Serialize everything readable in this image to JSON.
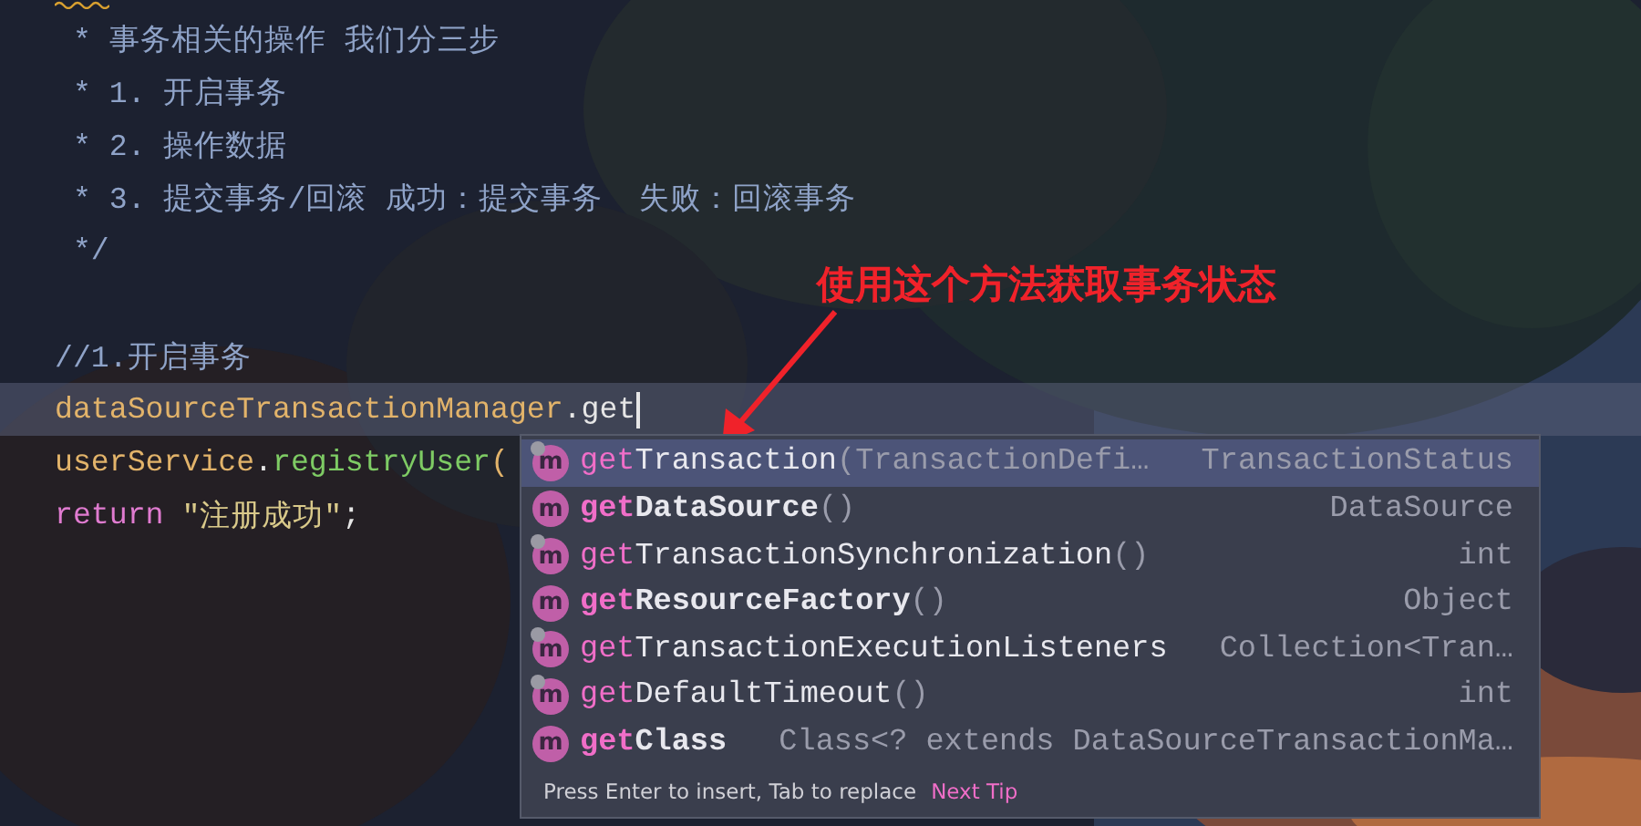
{
  "editor": {
    "lines": [
      {
        "current": false,
        "tokens": [
          {
            "kind": "comment",
            "text": " * 事务相关的操作 我们分三步"
          }
        ]
      },
      {
        "current": false,
        "tokens": [
          {
            "kind": "comment",
            "text": " * 1. 开启事务"
          }
        ]
      },
      {
        "current": false,
        "tokens": [
          {
            "kind": "comment",
            "text": " * 2. 操作数据"
          }
        ]
      },
      {
        "current": false,
        "tokens": [
          {
            "kind": "comment",
            "text": " * 3. 提交事务/回滚 成功：提交事务  失败：回滚事务"
          }
        ]
      },
      {
        "current": false,
        "tokens": [
          {
            "kind": "comment",
            "text": " */"
          }
        ]
      },
      {
        "current": false
      },
      {
        "current": false,
        "tokens": [
          {
            "kind": "comment",
            "text": "//1.开启事务"
          }
        ]
      },
      {
        "current": true,
        "tokens": [
          {
            "kind": "field",
            "text": "dataSourceTransactionManager"
          },
          {
            "kind": "plain",
            "text": ".get"
          }
        ]
      },
      {
        "current": false,
        "tokens": [
          {
            "kind": "field",
            "text": "userService"
          },
          {
            "kind": "plain",
            "text": "."
          },
          {
            "kind": "method",
            "text": "registryUser"
          },
          {
            "kind": "field",
            "text": "("
          }
        ]
      },
      {
        "current": false,
        "tokens": [
          {
            "kind": "keyword",
            "text": "return"
          },
          {
            "kind": "string",
            "text": " \"注册成功\""
          },
          {
            "kind": "plain",
            "text": ";"
          }
        ]
      }
    ]
  },
  "annotation": {
    "text": "使用这个方法获取事务状态"
  },
  "completion": {
    "items": [
      {
        "icon": "m",
        "prefix": "get",
        "name": "Transaction",
        "params": "(TransactionDefi…",
        "type": "TransactionStatus",
        "bold": false,
        "inherited": true,
        "selected": true
      },
      {
        "icon": "m",
        "prefix": "get",
        "name": "DataSource",
        "params": "()",
        "type": "DataSource",
        "bold": true,
        "inherited": false,
        "selected": false
      },
      {
        "icon": "m",
        "prefix": "get",
        "name": "TransactionSynchronization",
        "params": "()",
        "type": "int",
        "bold": false,
        "inherited": true,
        "selected": false
      },
      {
        "icon": "m",
        "prefix": "get",
        "name": "ResourceFactory",
        "params": "()",
        "type": "Object",
        "bold": true,
        "inherited": false,
        "selected": false
      },
      {
        "icon": "m",
        "prefix": "get",
        "name": "TransactionExecutionListeners",
        "type": "Collection<Tran…",
        "bold": false,
        "inherited": true,
        "selected": false
      },
      {
        "icon": "m",
        "prefix": "get",
        "name": "DefaultTimeout",
        "params": "()",
        "type": "int",
        "bold": false,
        "inherited": true,
        "selected": false
      },
      {
        "icon": "m",
        "prefix": "get",
        "name": "Class",
        "type": "Class<? extends DataSourceTransactionMa…",
        "bold": true,
        "inherited": false,
        "selected": false
      }
    ],
    "footer": {
      "hint": "Press Enter to insert, Tab to replace",
      "link": "Next Tip"
    }
  }
}
